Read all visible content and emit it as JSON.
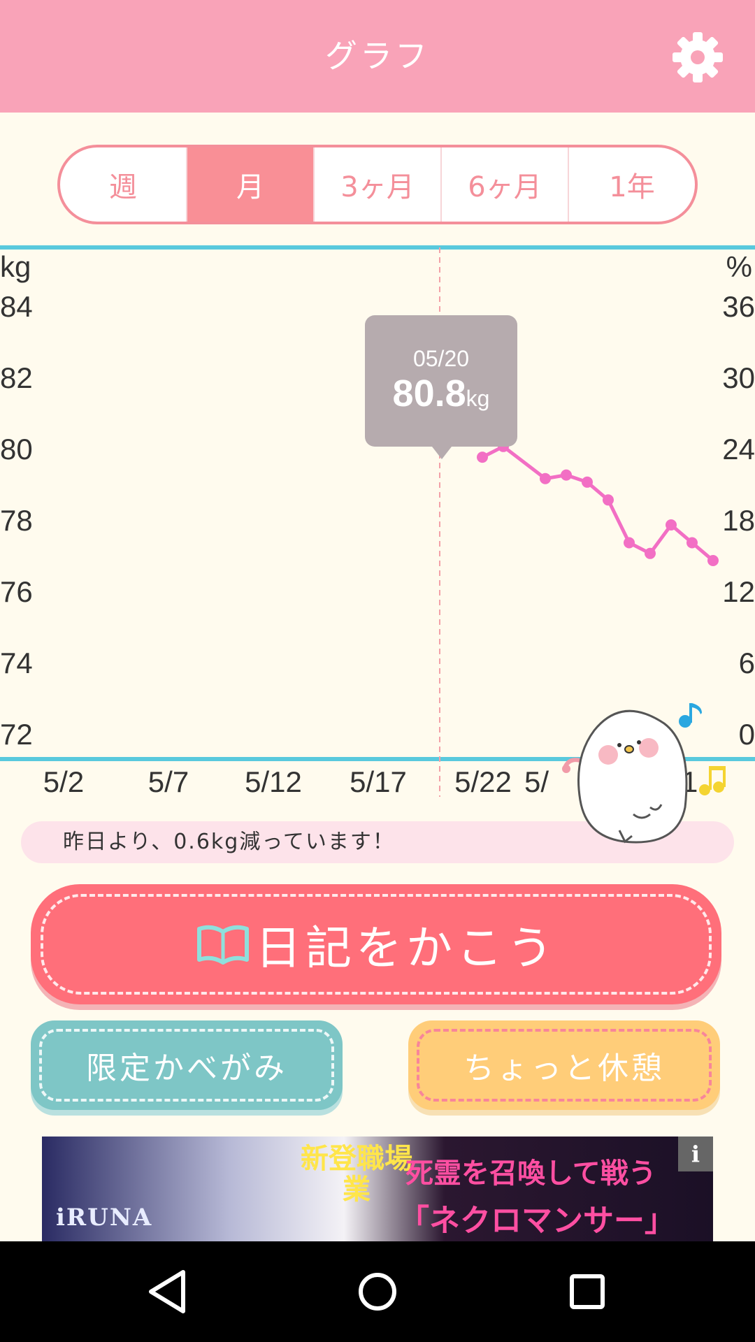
{
  "header": {
    "title": "グラフ"
  },
  "tabs": [
    {
      "label": "週",
      "active": false
    },
    {
      "label": "月",
      "active": true
    },
    {
      "label": "3ヶ月",
      "active": false
    },
    {
      "label": "6ヶ月",
      "active": false
    },
    {
      "label": "1年",
      "active": false
    }
  ],
  "chart": {
    "left_unit": "kg",
    "right_unit": "%",
    "left_ticks": [
      "84",
      "82",
      "80",
      "78",
      "76",
      "74",
      "72"
    ],
    "right_ticks": [
      "36",
      "30",
      "24",
      "18",
      "12",
      "6",
      "0"
    ],
    "x_ticks": [
      "5/2",
      "5/7",
      "5/12",
      "5/17",
      "5/22",
      "5/",
      "6/1"
    ],
    "tooltip": {
      "date": "05/20",
      "value": "80.8",
      "unit": "kg"
    }
  },
  "chart_data": {
    "type": "line",
    "x": [
      "5/21",
      "5/22",
      "5/24",
      "5/25",
      "5/26",
      "5/27",
      "5/28",
      "5/29",
      "5/30",
      "5/31",
      "6/1"
    ],
    "series": [
      {
        "values": [
          79.9,
          80.2,
          79.3,
          79.4,
          79.2,
          78.7,
          77.5,
          77.2,
          78.0,
          77.5,
          77.0
        ]
      }
    ],
    "ylim": [
      72,
      84
    ],
    "y2lim": [
      0,
      36
    ],
    "xlim": [
      "5/1",
      "6/1"
    ]
  },
  "message": "昨日より、0.6kg減っています！",
  "buttons": {
    "diary": "日記をかこう",
    "wallpaper": "限定かべがみ",
    "rest": "ちょっと休憩"
  },
  "ad": {
    "logo": "iRUNA",
    "newjob": "新登職場業",
    "line1": "死霊を召喚して戦う",
    "line2": "「ネクロマンサー」",
    "info": "i"
  },
  "colors": {
    "header": "#f9a3b8",
    "accent_pink": "#f98f96",
    "line": "#f26fc4",
    "axis": "#59c9dd",
    "background": "#fffbee"
  }
}
